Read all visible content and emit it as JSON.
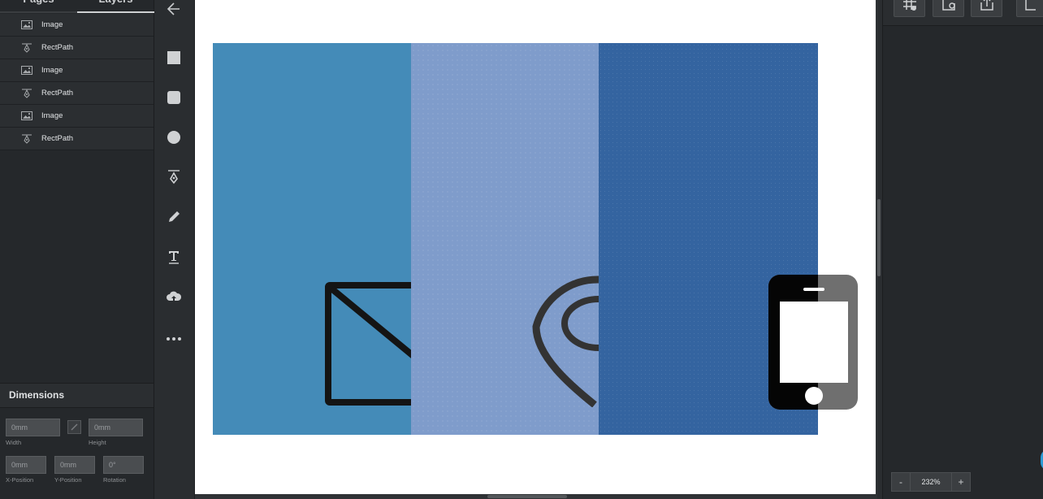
{
  "panel": {
    "tabs": [
      {
        "label": "Pages"
      },
      {
        "label": "Layers"
      }
    ]
  },
  "layers": [
    {
      "label": "Image",
      "icon": "image-icon"
    },
    {
      "label": "RectPath",
      "icon": "pen-tool-icon"
    },
    {
      "label": "Image",
      "icon": "image-icon"
    },
    {
      "label": "RectPath",
      "icon": "pen-tool-icon"
    },
    {
      "label": "Image",
      "icon": "image-icon"
    },
    {
      "label": "RectPath",
      "icon": "pen-tool-icon"
    }
  ],
  "dimensions": {
    "title": "Dimensions",
    "width": {
      "value": "0mm",
      "caption": "Width"
    },
    "height": {
      "value": "0mm",
      "caption": "Height"
    },
    "x": {
      "value": "0mm",
      "caption": "X-Position"
    },
    "y": {
      "value": "0mm",
      "caption": "Y-Position"
    },
    "rotation": {
      "value": "0°",
      "caption": "Rotation"
    }
  },
  "tools": [
    "back-arrow-icon",
    "rectangle-tool-icon",
    "rounded-rect-tool-icon",
    "circle-tool-icon",
    "pen-tool-icon",
    "pencil-tool-icon",
    "text-tool-icon",
    "upload-cloud-icon",
    "more-icon"
  ],
  "zoom": {
    "minus": "-",
    "value": "232%",
    "plus": "+"
  },
  "colors": {
    "panel": "#25282b",
    "blue1": "#448bb8",
    "blue2": "#7f9ccb",
    "blue3": "#3464a0",
    "accent": "#2d9bd6"
  }
}
